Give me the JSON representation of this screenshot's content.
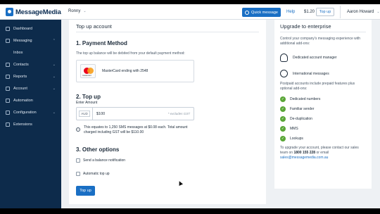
{
  "header": {
    "logo_text": "MessageMedia",
    "account": "Ronny",
    "quick_message": "Quick message",
    "help": "Help",
    "balance": "$1.20",
    "top_up": "Top up",
    "user": "Aaron Howard"
  },
  "sidebar": {
    "items": [
      {
        "label": "Dashboard",
        "icon": "dashboard-icon"
      },
      {
        "label": "Messaging",
        "icon": "messaging-icon"
      },
      {
        "label": "Inbox",
        "icon": "inbox-icon"
      },
      {
        "label": "Contacts",
        "icon": "contacts-icon"
      },
      {
        "label": "Reports",
        "icon": "reports-icon"
      },
      {
        "label": "Account",
        "icon": "account-icon"
      },
      {
        "label": "Automation",
        "icon": "automation-icon"
      },
      {
        "label": "Configuration",
        "icon": "configuration-icon"
      },
      {
        "label": "Extensions",
        "icon": "extensions-icon"
      }
    ]
  },
  "main": {
    "title": "Top up account",
    "payment": {
      "heading": "1. Payment Method",
      "note": "The top up balance will be debited from your default payment method:",
      "card_logo_text": "mastercard",
      "card_text": "MasterCard ending with 2548"
    },
    "topup": {
      "heading": "2. Top up",
      "amount_label": "Enter Amount",
      "currency": "AUD",
      "amount": "$100",
      "excludes": "* excludes GST",
      "info": "This equates to 1,250 SMS messages at $0.08 each. Total amount charged including GST will be $110.00"
    },
    "other": {
      "heading": "3. Other options",
      "send_notification": "Send a balance notification",
      "automatic": "Automatic top up"
    },
    "submit": "Top up"
  },
  "enterprise": {
    "title": "Upgrade to enterprise",
    "intro": "Control your company's messaging experience with additional add-ons:",
    "features": [
      "Dedicated account manager",
      "International messages"
    ],
    "postpaid": "Postpaid accounts include prepaid features plus optional add-ons:",
    "checks": [
      "Dedicated numbers",
      "Familiar sender",
      "De-duplication",
      "MMS",
      "Lookups"
    ],
    "contact_pre": "To upgrade your account, please contact our sales team on",
    "phone": "1800 155 228",
    "contact_mid": "or email",
    "email": "sales@messagemedia.com.au"
  },
  "colors": {
    "brand": "#1a6fc4",
    "sidebar": "#0d2b4b",
    "check": "#5aa637"
  }
}
